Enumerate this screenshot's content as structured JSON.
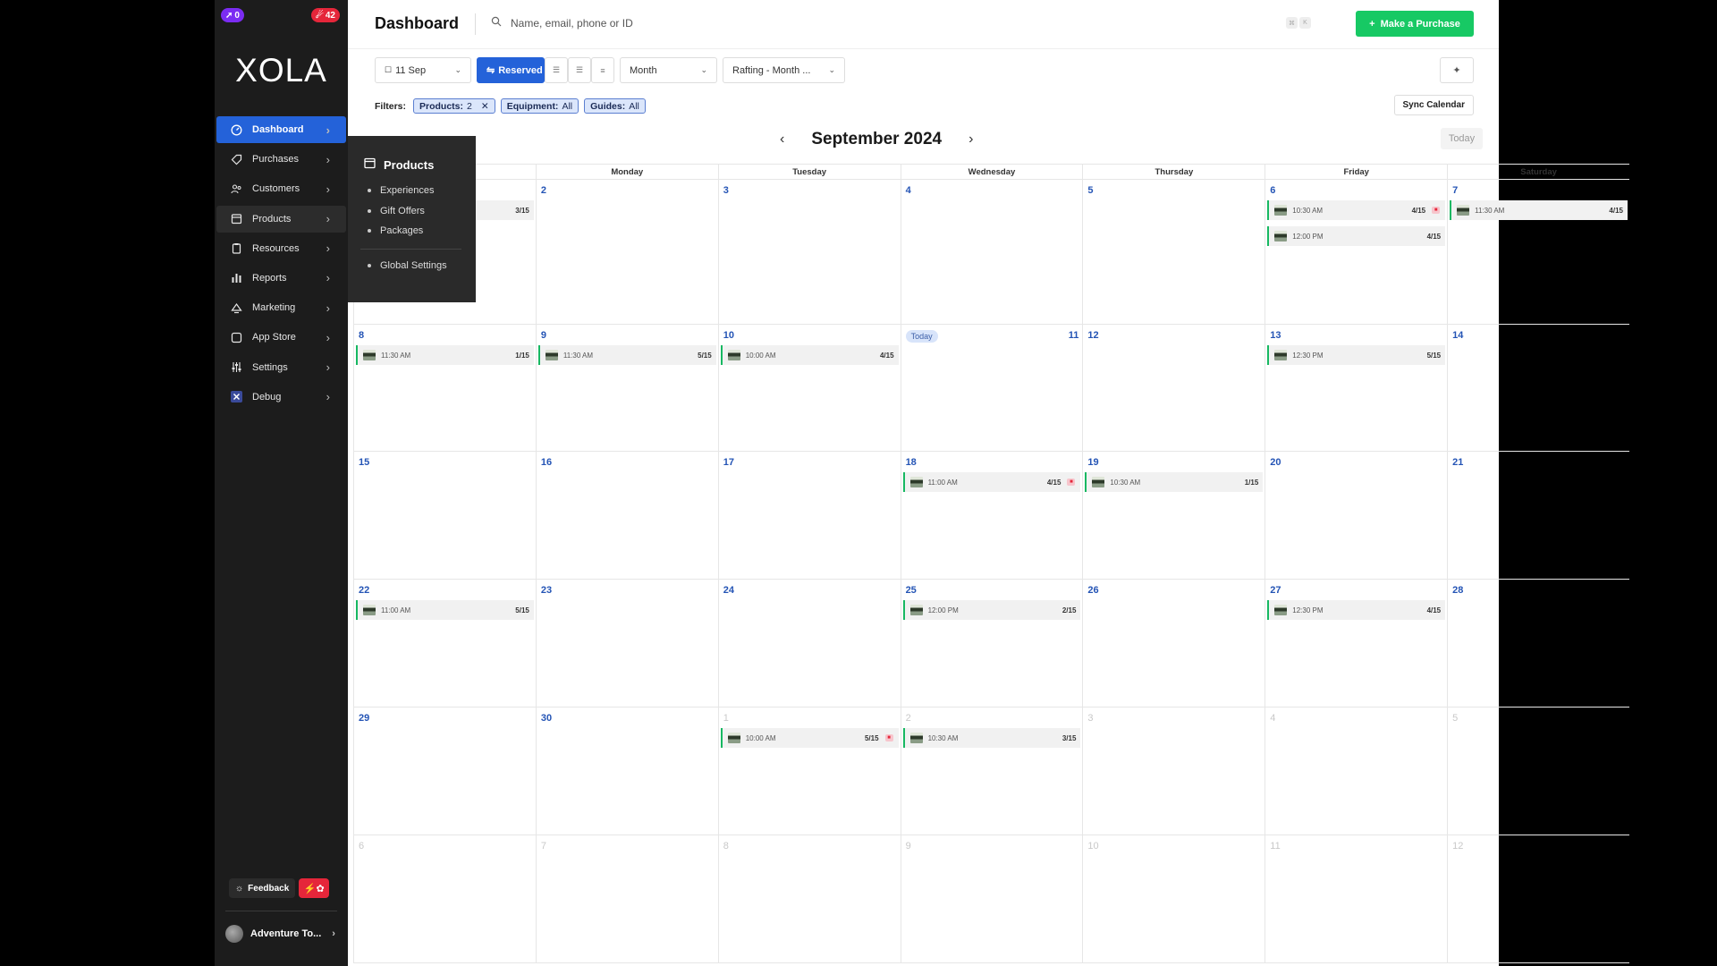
{
  "badges": {
    "notifications": "0",
    "alerts": "42"
  },
  "brand": "XOLA",
  "nav": [
    {
      "label": "Dashboard",
      "key": "dashboard",
      "icon": "dashboard-icon",
      "state": "active"
    },
    {
      "label": "Purchases",
      "key": "purchases",
      "icon": "tag-icon",
      "state": ""
    },
    {
      "label": "Customers",
      "key": "customers",
      "icon": "users-icon",
      "state": ""
    },
    {
      "label": "Products",
      "key": "products",
      "icon": "box-icon",
      "state": "hover"
    },
    {
      "label": "Resources",
      "key": "resources",
      "icon": "clipboard-icon",
      "state": ""
    },
    {
      "label": "Reports",
      "key": "reports",
      "icon": "bar-chart-icon",
      "state": ""
    },
    {
      "label": "Marketing",
      "key": "marketing",
      "icon": "megaphone-icon",
      "state": ""
    },
    {
      "label": "App Store",
      "key": "app-store",
      "icon": "app-icon",
      "state": ""
    },
    {
      "label": "Settings",
      "key": "settings",
      "icon": "sliders-icon",
      "state": ""
    },
    {
      "label": "Debug",
      "key": "debug",
      "icon": "debug-x-icon",
      "state": ""
    }
  ],
  "flyout": {
    "title": "Products",
    "items": [
      "Experiences",
      "Gift Offers",
      "Packages"
    ],
    "footer_item": "Global Settings"
  },
  "feedback_label": "Feedback",
  "account_name": "Adventure To...",
  "header": {
    "title": "Dashboard",
    "search_placeholder": "Name, email, phone or ID",
    "kbd": [
      "⌘",
      "K"
    ],
    "purchase_label": "Make a Purchase"
  },
  "toolbar": {
    "date": "11 Sep",
    "reserved": "Reserved",
    "view": "Month",
    "product_select": "Rafting - Month ..."
  },
  "filters": {
    "label": "Filters:",
    "products_label": "Products:",
    "products_value": "2",
    "equipment_label": "Equipment:",
    "equipment_value": "All",
    "guides_label": "Guides:",
    "guides_value": "All",
    "sync_label": "Sync Calendar"
  },
  "calendar": {
    "month_title": "September 2024",
    "today_label": "Today",
    "today_pill": "Today",
    "weekdays": [
      "",
      "Monday",
      "Tuesday",
      "Wednesday",
      "Thursday",
      "Friday",
      "Saturday"
    ],
    "weeks": [
      {
        "days": [
          {
            "n": "",
            "other": false,
            "events": [
              {
                "time": "",
                "count": "3/15",
                "flag": false
              }
            ]
          },
          {
            "n": "2",
            "other": false,
            "events": []
          },
          {
            "n": "3",
            "other": false,
            "events": []
          },
          {
            "n": "4",
            "other": false,
            "events": []
          },
          {
            "n": "5",
            "other": false,
            "events": []
          },
          {
            "n": "6",
            "other": false,
            "events": [
              {
                "time": "10:30 AM",
                "count": "4/15",
                "flag": true
              },
              {
                "time": "12:00 PM",
                "count": "4/15",
                "flag": false
              }
            ]
          },
          {
            "n": "7",
            "other": false,
            "events": [
              {
                "time": "11:30 AM",
                "count": "4/15",
                "flag": false
              }
            ]
          }
        ]
      },
      {
        "days": [
          {
            "n": "8",
            "other": false,
            "events": [
              {
                "time": "11:30 AM",
                "count": "1/15",
                "flag": false
              }
            ]
          },
          {
            "n": "9",
            "other": false,
            "events": [
              {
                "time": "11:30 AM",
                "count": "5/15",
                "flag": false
              }
            ]
          },
          {
            "n": "10",
            "other": false,
            "events": [
              {
                "time": "10:00 AM",
                "count": "4/15",
                "flag": false
              }
            ]
          },
          {
            "n": "11",
            "other": false,
            "today": true,
            "events": []
          },
          {
            "n": "12",
            "other": false,
            "events": []
          },
          {
            "n": "13",
            "other": false,
            "events": [
              {
                "time": "12:30 PM",
                "count": "5/15",
                "flag": false
              }
            ]
          },
          {
            "n": "14",
            "other": false,
            "events": []
          }
        ]
      },
      {
        "days": [
          {
            "n": "15",
            "other": false,
            "events": []
          },
          {
            "n": "16",
            "other": false,
            "events": []
          },
          {
            "n": "17",
            "other": false,
            "events": []
          },
          {
            "n": "18",
            "other": false,
            "events": [
              {
                "time": "11:00 AM",
                "count": "4/15",
                "flag": true
              }
            ]
          },
          {
            "n": "19",
            "other": false,
            "events": [
              {
                "time": "10:30 AM",
                "count": "1/15",
                "flag": false
              }
            ]
          },
          {
            "n": "20",
            "other": false,
            "events": []
          },
          {
            "n": "21",
            "other": false,
            "events": []
          }
        ]
      },
      {
        "days": [
          {
            "n": "22",
            "other": false,
            "events": [
              {
                "time": "11:00 AM",
                "count": "5/15",
                "flag": false
              }
            ]
          },
          {
            "n": "23",
            "other": false,
            "events": []
          },
          {
            "n": "24",
            "other": false,
            "events": []
          },
          {
            "n": "25",
            "other": false,
            "events": [
              {
                "time": "12:00 PM",
                "count": "2/15",
                "flag": false
              }
            ]
          },
          {
            "n": "26",
            "other": false,
            "events": []
          },
          {
            "n": "27",
            "other": false,
            "events": [
              {
                "time": "12:30 PM",
                "count": "4/15",
                "flag": false
              }
            ]
          },
          {
            "n": "28",
            "other": false,
            "events": []
          }
        ]
      },
      {
        "days": [
          {
            "n": "29",
            "other": false,
            "events": []
          },
          {
            "n": "30",
            "other": false,
            "events": []
          },
          {
            "n": "1",
            "other": true,
            "events": [
              {
                "time": "10:00 AM",
                "count": "5/15",
                "flag": true
              }
            ]
          },
          {
            "n": "2",
            "other": true,
            "events": [
              {
                "time": "10:30 AM",
                "count": "3/15",
                "flag": false
              }
            ]
          },
          {
            "n": "3",
            "other": true,
            "events": []
          },
          {
            "n": "4",
            "other": true,
            "events": []
          },
          {
            "n": "5",
            "other": true,
            "events": []
          }
        ]
      },
      {
        "days": [
          {
            "n": "6",
            "other": true,
            "events": []
          },
          {
            "n": "7",
            "other": true,
            "events": []
          },
          {
            "n": "8",
            "other": true,
            "events": []
          },
          {
            "n": "9",
            "other": true,
            "events": []
          },
          {
            "n": "10",
            "other": true,
            "events": []
          },
          {
            "n": "11",
            "other": true,
            "events": []
          },
          {
            "n": "12",
            "other": true,
            "events": []
          }
        ]
      }
    ]
  }
}
